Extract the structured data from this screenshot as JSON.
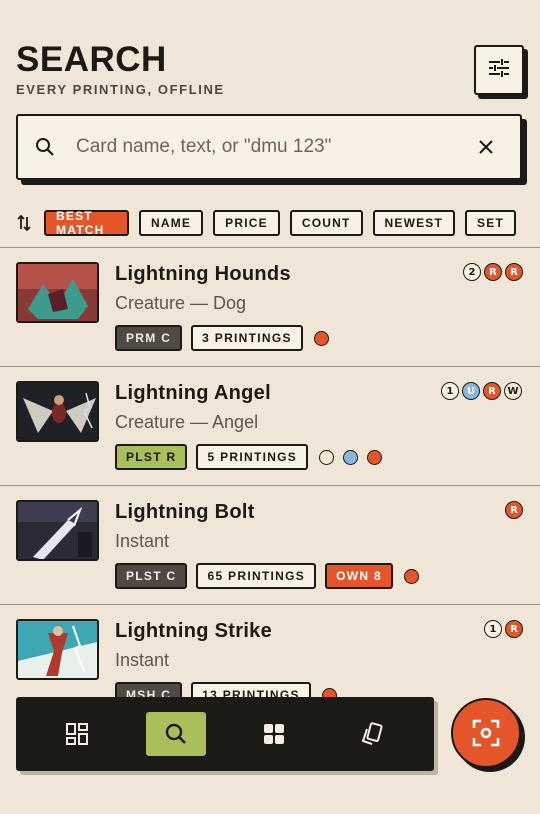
{
  "header": {
    "title": "SEARCH",
    "subtitle": "EVERY PRINTING, OFFLINE"
  },
  "search": {
    "placeholder": "Card name, text, or \"dmu 123\"",
    "value": ""
  },
  "sort": {
    "options": [
      {
        "label": "BEST MATCH",
        "active": true
      },
      {
        "label": "NAME",
        "active": false
      },
      {
        "label": "PRICE",
        "active": false
      },
      {
        "label": "COUNT",
        "active": false
      },
      {
        "label": "NEWEST",
        "active": false
      },
      {
        "label": "SET",
        "active": false
      }
    ]
  },
  "cards": [
    {
      "name": "Lightning Hounds",
      "type": "Creature — Dog",
      "set": "PRM C",
      "set_color": "#4f4a43",
      "printings": "3 PRINTINGS",
      "own": "",
      "dots": [
        "#e4562a"
      ],
      "mana": [
        {
          "t": "2",
          "c": "#f8f2e6"
        },
        {
          "t": "R",
          "c": "#e4562a"
        },
        {
          "t": "R",
          "c": "#e4562a"
        }
      ]
    },
    {
      "name": "Lightning Angel",
      "type": "Creature — Angel",
      "set": "PLST R",
      "set_color": "#a8bf5c",
      "printings": "5 PRINTINGS",
      "own": "",
      "dots": [
        "#f3ead2",
        "#8bb6dd",
        "#e4562a"
      ],
      "mana": [
        {
          "t": "1",
          "c": "#f8f2e6"
        },
        {
          "t": "U",
          "c": "#8bb6dd"
        },
        {
          "t": "R",
          "c": "#e4562a"
        },
        {
          "t": "W",
          "c": "#f3ead2"
        }
      ]
    },
    {
      "name": "Lightning Bolt",
      "type": "Instant",
      "set": "PLST C",
      "set_color": "#4f4a43",
      "printings": "65 PRINTINGS",
      "own": "OWN 8",
      "dots": [
        "#e4562a"
      ],
      "mana": [
        {
          "t": "R",
          "c": "#e4562a"
        }
      ]
    },
    {
      "name": "Lightning Strike",
      "type": "Instant",
      "set": "MSH C",
      "set_color": "#4f4a43",
      "printings": "13 PRINTINGS",
      "own": "",
      "dots": [
        "#e4562a"
      ],
      "mana": [
        {
          "t": "1",
          "c": "#f8f2e6"
        },
        {
          "t": "R",
          "c": "#e4562a"
        }
      ]
    }
  ],
  "nav": {
    "items": [
      {
        "icon": "dashboard-icon",
        "active": false
      },
      {
        "icon": "search-icon",
        "active": true
      },
      {
        "icon": "grid-icon",
        "active": false
      },
      {
        "icon": "cards-icon",
        "active": false
      }
    ],
    "fab_icon": "scan-icon"
  },
  "colors": {
    "accent": "#e4562a",
    "green": "#a8bf5c",
    "ink": "#1c1a17",
    "background": "#efe6d8"
  }
}
